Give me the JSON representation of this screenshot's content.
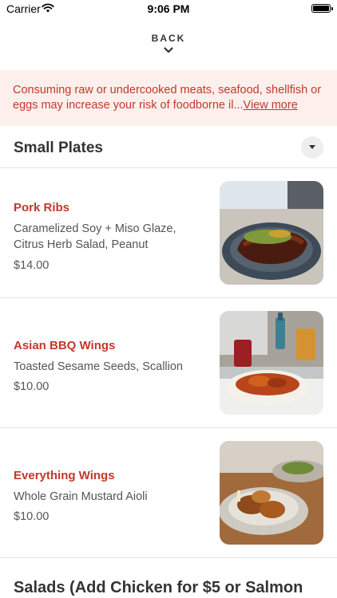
{
  "status_bar": {
    "carrier": "Carrier",
    "time": "9:06 PM"
  },
  "back": {
    "label": "BACK"
  },
  "notice": {
    "text": "Consuming raw or undercooked meats, seafood, shellfish or eggs may increase your risk of foodborne il...",
    "link": "View more"
  },
  "section": {
    "title": "Small Plates"
  },
  "items": [
    {
      "name": "Pork Ribs",
      "description": "Caramelized Soy + Miso Glaze, Citrus Herb Salad, Peanut",
      "price": "$14.00",
      "photo": "pork-ribs-photo"
    },
    {
      "name": "Asian BBQ Wings",
      "description": "Toasted Sesame Seeds, Scallion",
      "price": "$10.00",
      "photo": "asian-bbq-wings-photo"
    },
    {
      "name": "Everything Wings",
      "description": "Whole Grain Mustard Aioli",
      "price": "$10.00",
      "photo": "everything-wings-photo"
    }
  ],
  "next_section": {
    "title": "Salads (Add Chicken for $5 or Salmon"
  },
  "colors": {
    "accent": "#c0392b",
    "notice_bg": "#fdf0ec",
    "divider": "#e5e5e5"
  }
}
